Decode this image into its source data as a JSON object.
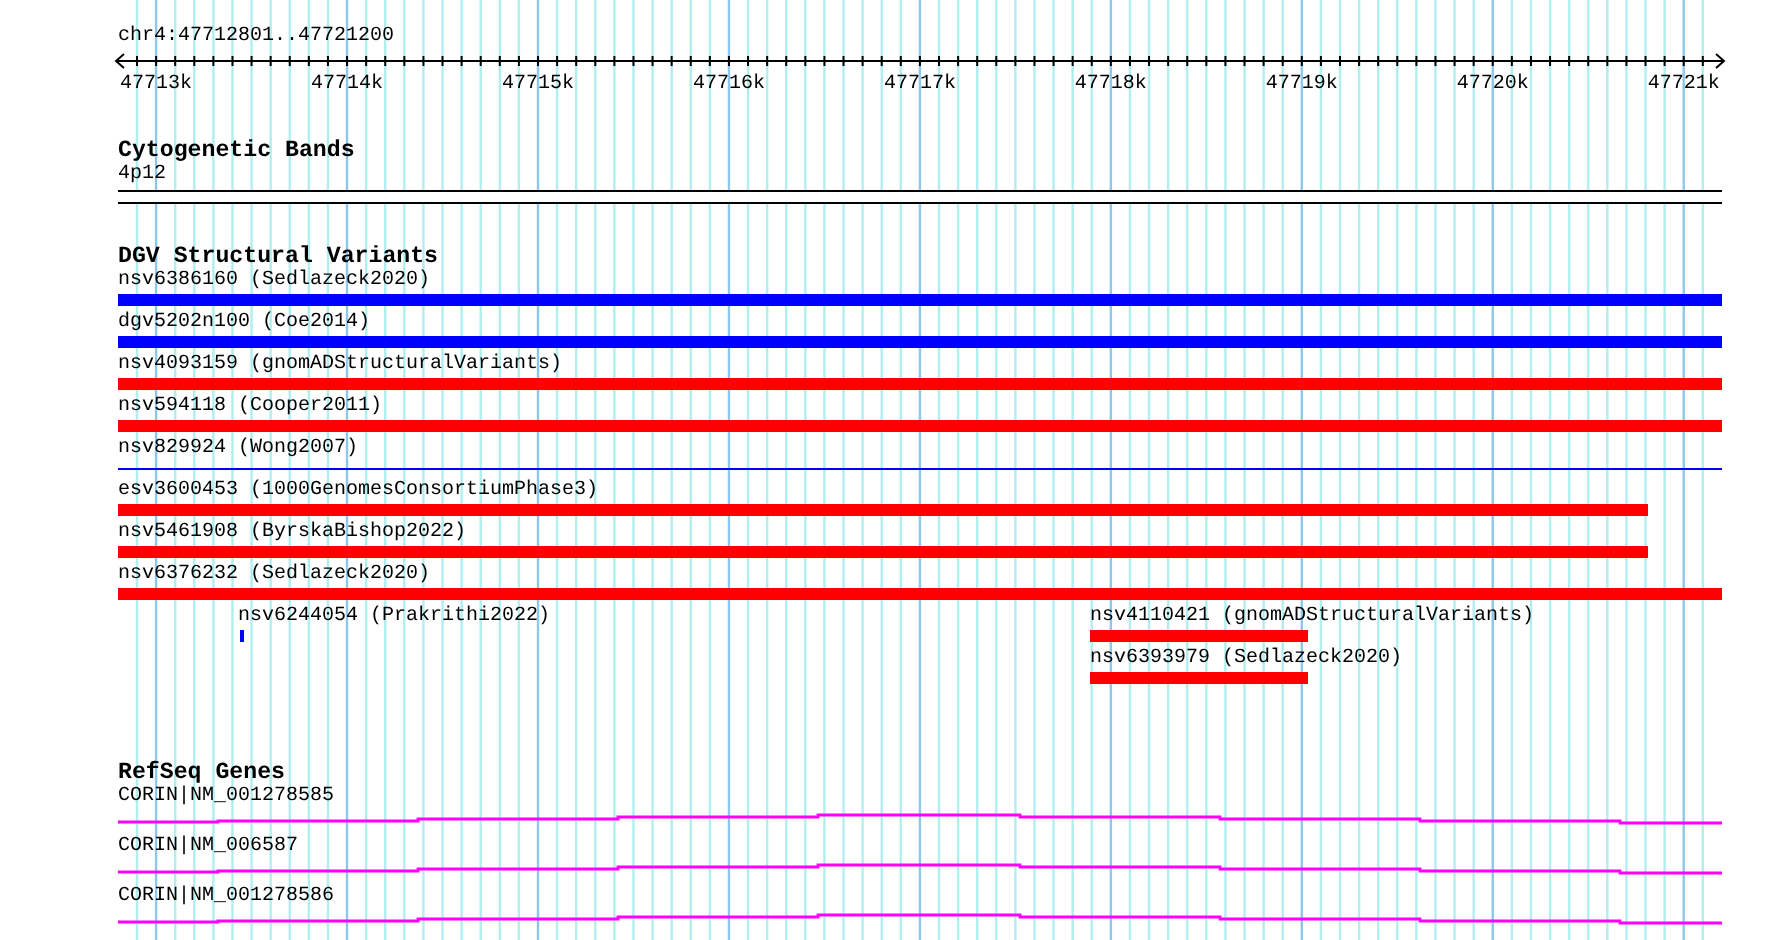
{
  "ruler": {
    "position": "chr4:47712801..47721200",
    "ticks": [
      "47713k",
      "47714k",
      "47715k",
      "47716k",
      "47717k",
      "47718k",
      "47719k",
      "47720k",
      "47721k"
    ]
  },
  "tracks": [
    {
      "kind": "cytoband",
      "title": "Cytogenetic Bands",
      "bands": [
        {
          "label": "4p12"
        }
      ]
    },
    {
      "kind": "variants",
      "title": "DGV Structural Variants",
      "features": [
        {
          "label": "nsv6386160 (Sedlazeck2020)",
          "color": "#0000ff",
          "kind": "bar"
        },
        {
          "label": "dgv5202n100 (Coe2014)",
          "color": "#0000ff",
          "kind": "bar"
        },
        {
          "label": "nsv4093159 (gnomADStructuralVariants)",
          "color": "#ff0000",
          "kind": "bar"
        },
        {
          "label": "nsv594118 (Cooper2011)",
          "color": "#ff0000",
          "kind": "bar"
        },
        {
          "label": "nsv829924 (Wong2007)",
          "color": "#0000ff",
          "kind": "line"
        },
        {
          "label": "esv3600453 (1000GenomesConsortiumPhase3)",
          "color": "#ff0000",
          "kind": "bar"
        },
        {
          "label": "nsv5461908 (ByrskaBishop2022)",
          "color": "#ff0000",
          "kind": "bar"
        },
        {
          "label": "nsv6376232 (Sedlazeck2020)",
          "color": "#ff0000",
          "kind": "bar"
        },
        {
          "label": "nsv6244054 (Prakrithi2022)",
          "color": "#0000ff",
          "kind": "tick"
        },
        {
          "label": "nsv4110421 (gnomADStructuralVariants)",
          "color": "#ff0000",
          "kind": "bar"
        },
        {
          "label": "nsv6393979 (Sedlazeck2020)",
          "color": "#ff0000",
          "kind": "bar"
        }
      ]
    },
    {
      "kind": "genes",
      "title": "RefSeq Genes",
      "genes": [
        {
          "label": "CORIN|NM_001278585",
          "color": "#ff00ff"
        },
        {
          "label": "CORIN|NM_006587",
          "color": "#ff00ff"
        },
        {
          "label": "CORIN|NM_001278586",
          "color": "#ff00ff"
        }
      ]
    }
  ]
}
